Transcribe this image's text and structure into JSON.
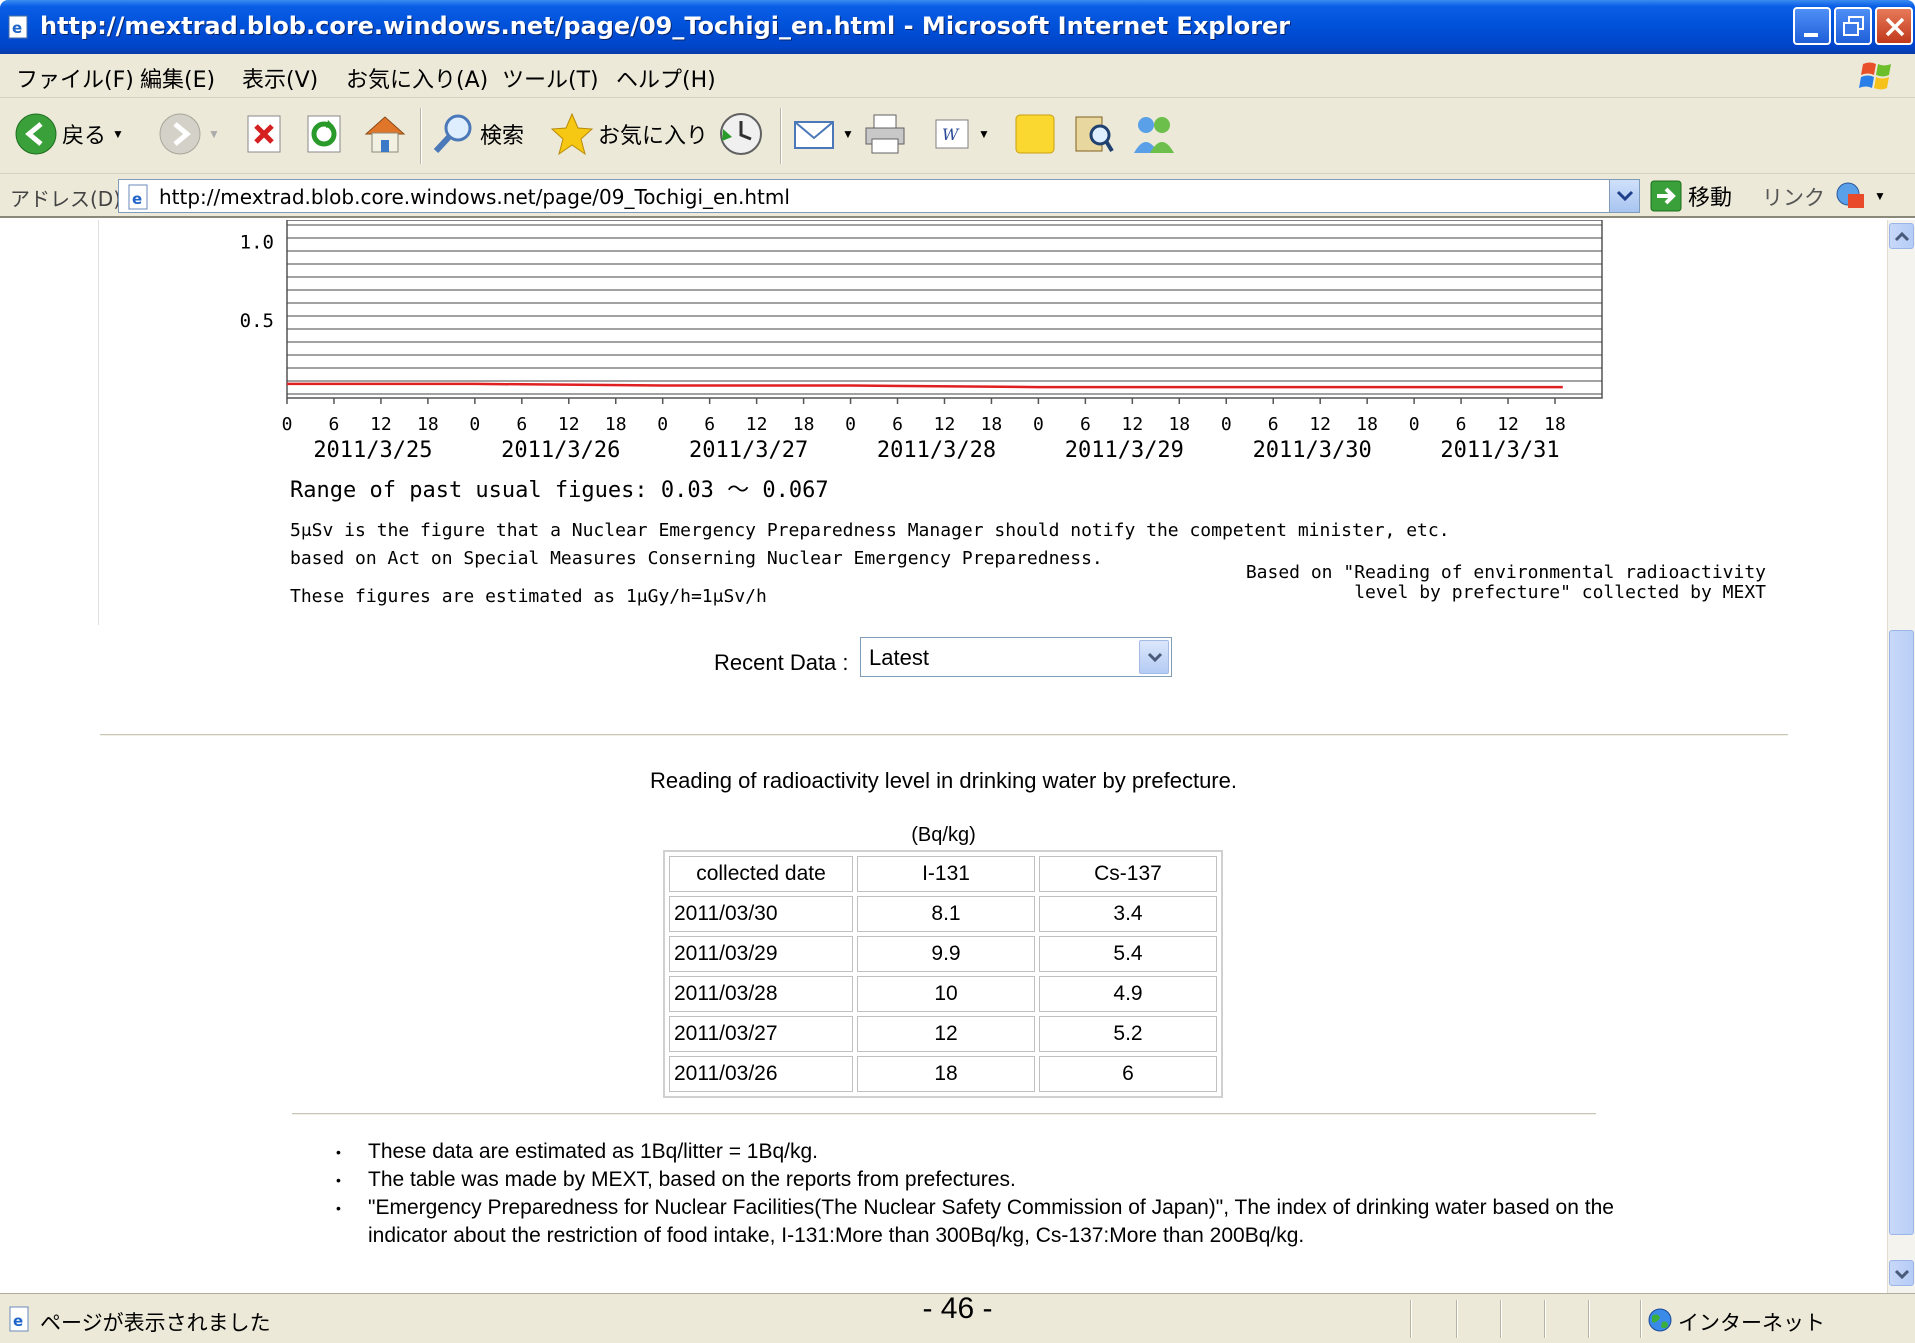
{
  "window": {
    "title": "http://mextrad.blob.core.windows.net/page/09_Tochigi_en.html - Microsoft Internet Explorer"
  },
  "menu": {
    "items": [
      "ファイル(F)",
      "編集(E)",
      "表示(V)",
      "お気に入り(A)",
      "ツール(T)",
      "ヘルプ(H)"
    ]
  },
  "toolbar": {
    "back_label": "戻る",
    "search_label": "検索",
    "favorites_label": "お気に入り"
  },
  "address": {
    "label": "アドレス(D)",
    "url": "http://mextrad.blob.core.windows.net/page/09_Tochigi_en.html",
    "go_label": "移動",
    "links_label": "リンク"
  },
  "chart_data": {
    "type": "line",
    "title": "",
    "xlabel": "",
    "ylabel": "",
    "y_tick_labels": [
      "1.0",
      "0.5"
    ],
    "x_tick_labels": [
      "0",
      "6",
      "12",
      "18",
      "0",
      "6",
      "12",
      "18",
      "0",
      "6",
      "12",
      "18",
      "0",
      "6",
      "12",
      "18",
      "0",
      "6",
      "12",
      "18",
      "0",
      "6",
      "12",
      "18",
      "0",
      "6",
      "12",
      "18"
    ],
    "date_labels": [
      "2011/3/25",
      "2011/3/26",
      "2011/3/27",
      "2011/3/28",
      "2011/3/29",
      "2011/3/30",
      "2011/3/31"
    ],
    "grid": true,
    "series": [
      {
        "color": "#e02020",
        "x_hours": [
          0,
          24,
          48,
          72,
          96,
          120,
          144,
          163
        ],
        "values": [
          0.09,
          0.09,
          0.08,
          0.08,
          0.07,
          0.07,
          0.07,
          0.07
        ]
      }
    ]
  },
  "notes": {
    "range": "Range of past usual figues: 0.03 ～ 0.067",
    "line1": "5μSv is the figure that a Nuclear Emergency Preparedness Manager should notify the competent minister, etc.",
    "line2": "based on Act on Special Measures Conserning Nuclear Emergency Preparedness.",
    "line3": "These figures are estimated as 1μGy/h=1μSv/h",
    "credit1": "Based on \"Reading of environmental radioactivity",
    "credit2": "level by prefecture\" collected by MEXT"
  },
  "recent": {
    "label": "Recent Data :",
    "selected": "Latest"
  },
  "water": {
    "title": "Reading of radioactivity level in drinking water by prefecture.",
    "unit": "(Bq/kg)",
    "headers": [
      "collected date",
      "I-131",
      "Cs-137"
    ],
    "rows": [
      [
        "2011/03/30",
        "8.1",
        "3.4"
      ],
      [
        "2011/03/29",
        "9.9",
        "5.4"
      ],
      [
        "2011/03/28",
        "10",
        "4.9"
      ],
      [
        "2011/03/27",
        "12",
        "5.2"
      ],
      [
        "2011/03/26",
        "18",
        "6"
      ]
    ]
  },
  "bullets": [
    "These data are estimated as 1Bq/litter = 1Bq/kg.",
    "The table was made by MEXT, based on the reports from prefectures.",
    "\"Emergency Preparedness for Nuclear Facilities(The Nuclear Safety Commission of Japan)\", The index of drinking water based on the indicator about the restriction of food intake, I-131:More than 300Bq/kg, Cs-137:More than 200Bq/kg."
  ],
  "page_number": "- 46 -",
  "status": {
    "text": "ページが表示されました",
    "zone": "インターネット"
  }
}
